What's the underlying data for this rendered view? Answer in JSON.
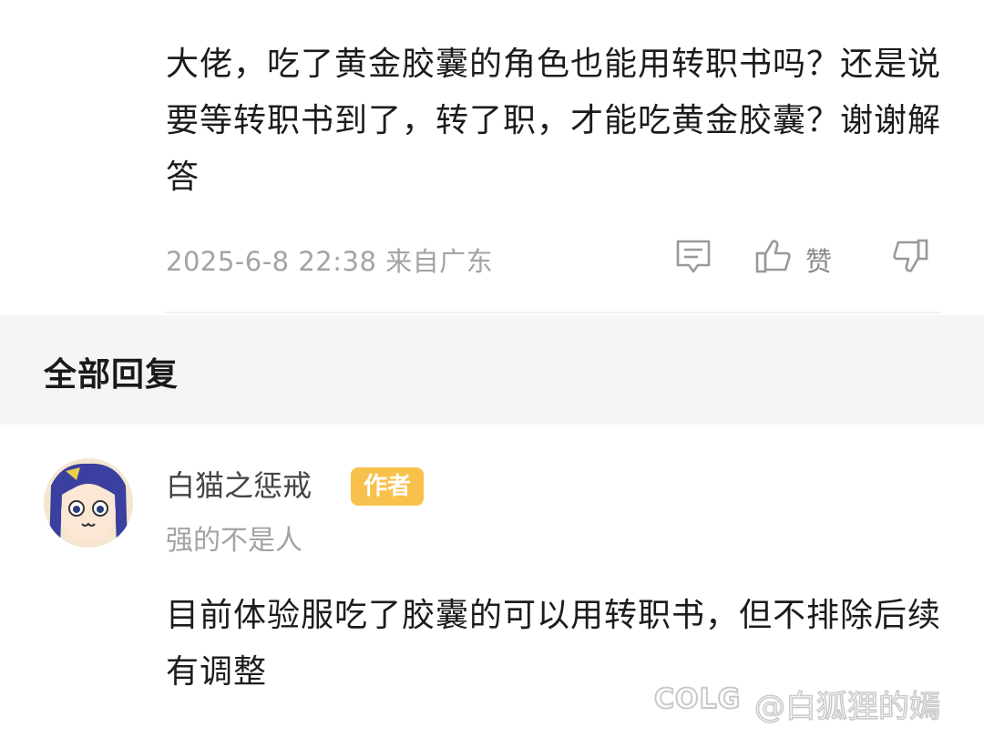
{
  "post": {
    "question_text": "大佬，吃了黄金胶囊的角色也能用转职书吗？还是说要等转职书到了，转了职，才能吃黄金胶囊？谢谢解答",
    "timestamp": "2025-6-8 22:38",
    "location": "来自广东",
    "like_label": "赞"
  },
  "replies_section": {
    "title": "全部回复"
  },
  "reply": {
    "author_name": "白猫之惩戒",
    "author_badge": "作者",
    "author_signature": "强的不是人",
    "text": "目前体验服吃了胶囊的可以用转职书，但不排除后续有调整"
  },
  "watermark": {
    "logo": "COLG",
    "text": "@白狐狸的嫣"
  },
  "icons": {
    "comment": "comment-icon",
    "like": "thumbs-up-icon",
    "dislike": "thumbs-down-icon",
    "avatar": "anime-avatar"
  },
  "colors": {
    "badge": "#f8c14b",
    "meta_gray": "#a3a3a3",
    "section_bg": "#f5f5f5"
  }
}
